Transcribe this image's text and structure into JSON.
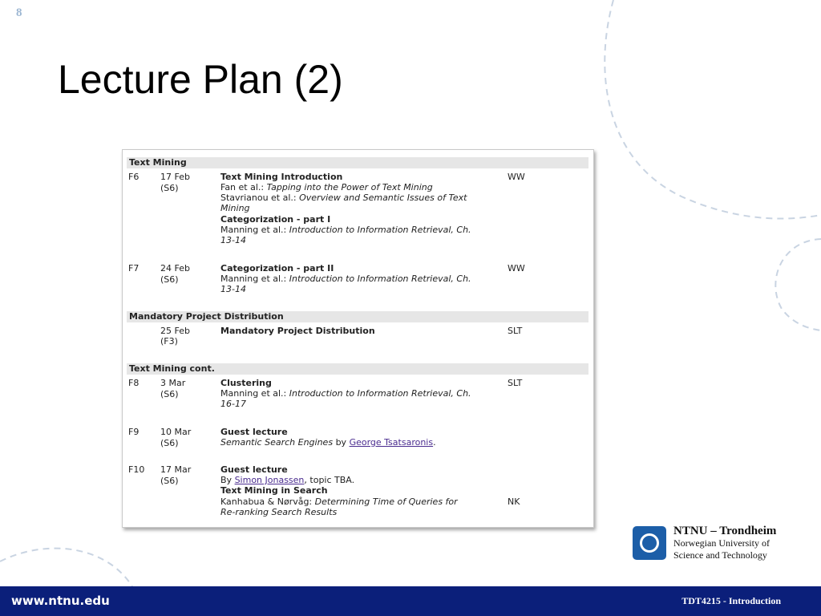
{
  "slide": {
    "number": "8",
    "title": "Lecture Plan (2)"
  },
  "schedule": {
    "sections": [
      {
        "title": "Text Mining"
      },
      {
        "title": "Mandatory Project Distribution"
      },
      {
        "title": "Text Mining cont."
      }
    ],
    "rows": [
      {
        "id": "F6",
        "date": "17 Feb",
        "room": "(S6)",
        "lecturer": "WW",
        "topic1": "Text Mining Introduction",
        "ref1_author": "Fan et al.:",
        "ref1_title": "Tapping into the Power of Text Mining",
        "ref2_author": "Stavrianou et al.:",
        "ref2_title_a": "Overview and Semantic Issues of Text",
        "ref2_title_b": "Mining",
        "topic2": "Categorization - part I",
        "ref3_author": "Manning et al.:",
        "ref3_title_a": "Introduction to Information Retrieval, Ch.",
        "ref3_title_b": "13-14"
      },
      {
        "id": "F7",
        "date": "24 Feb",
        "room": "(S6)",
        "lecturer": "WW",
        "topic1": "Categorization - part II",
        "ref1_author": "Manning et al.:",
        "ref1_title_a": "Introduction to Information Retrieval, Ch.",
        "ref1_title_b": "13-14"
      },
      {
        "id": "",
        "date": "25 Feb",
        "room": "(F3)",
        "lecturer": "SLT",
        "topic1": "Mandatory Project Distribution"
      },
      {
        "id": "F8",
        "date": "3 Mar",
        "room": "(S6)",
        "lecturer": "SLT",
        "topic1": "Clustering",
        "ref1_author": "Manning et al.:",
        "ref1_title_a": "Introduction to Information Retrieval, Ch.",
        "ref1_title_b": "16-17"
      },
      {
        "id": "F9",
        "date": "10 Mar",
        "room": "(S6)",
        "lecturer": "",
        "topic1": "Guest lecture",
        "desc_title": "Semantic Search Engines",
        "desc_by": "by",
        "desc_link": "George Tsatsaronis",
        "desc_end": "."
      },
      {
        "id": "F10",
        "date": "17 Mar",
        "room": "(S6)",
        "lecturer": "NK",
        "topic1": "Guest lecture",
        "desc_by": "By",
        "desc_link": "Simon Jonassen",
        "desc_end": ", topic TBA.",
        "topic2": "Text Mining in Search",
        "ref1_author": "Kanhabua & Nørvåg:",
        "ref1_title_a": "Determining Time of Queries for",
        "ref1_title_b": "Re-ranking Search Results"
      }
    ]
  },
  "branding": {
    "institution_line1": "NTNU – Trondheim",
    "institution_line2": "Norwegian University of",
    "institution_line3": "Science and Technology",
    "footer_url": "www.ntnu.edu",
    "footer_course": "TDT4215 - Introduction"
  },
  "colors": {
    "footer_bg": "#0b1f7a",
    "logo_blue": "#1c5ea8",
    "section_header_bg": "#e6e6e6",
    "link": "#4a2c8f"
  }
}
